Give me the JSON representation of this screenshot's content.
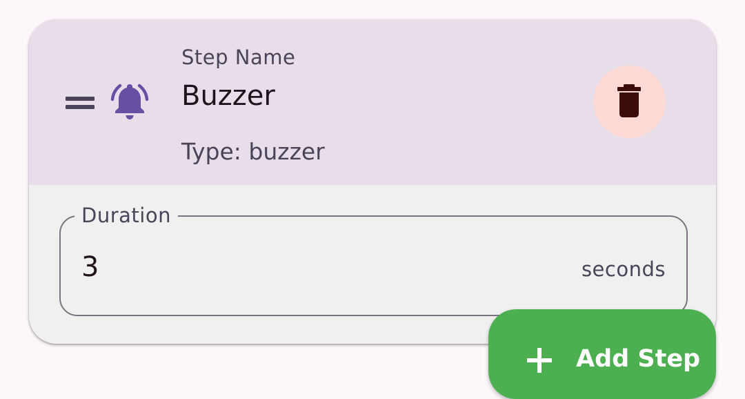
{
  "step": {
    "name_label": "Step Name",
    "name": "Buzzer",
    "type_text": "Type: buzzer",
    "icon": "bell-icon",
    "drag_icon": "drag-handle-icon",
    "delete_icon": "trash-icon"
  },
  "duration_field": {
    "label": "Duration",
    "value": "3",
    "suffix": "seconds"
  },
  "fab": {
    "label": "Add Step",
    "icon": "plus-icon"
  },
  "colors": {
    "header_bg": "#e7dee9",
    "card_bg": "#f0f0f0",
    "accent": "#6750a4",
    "delete_bg": "#fcd9d5",
    "delete_icon": "#410e0b",
    "fab_bg": "#4caf50"
  }
}
